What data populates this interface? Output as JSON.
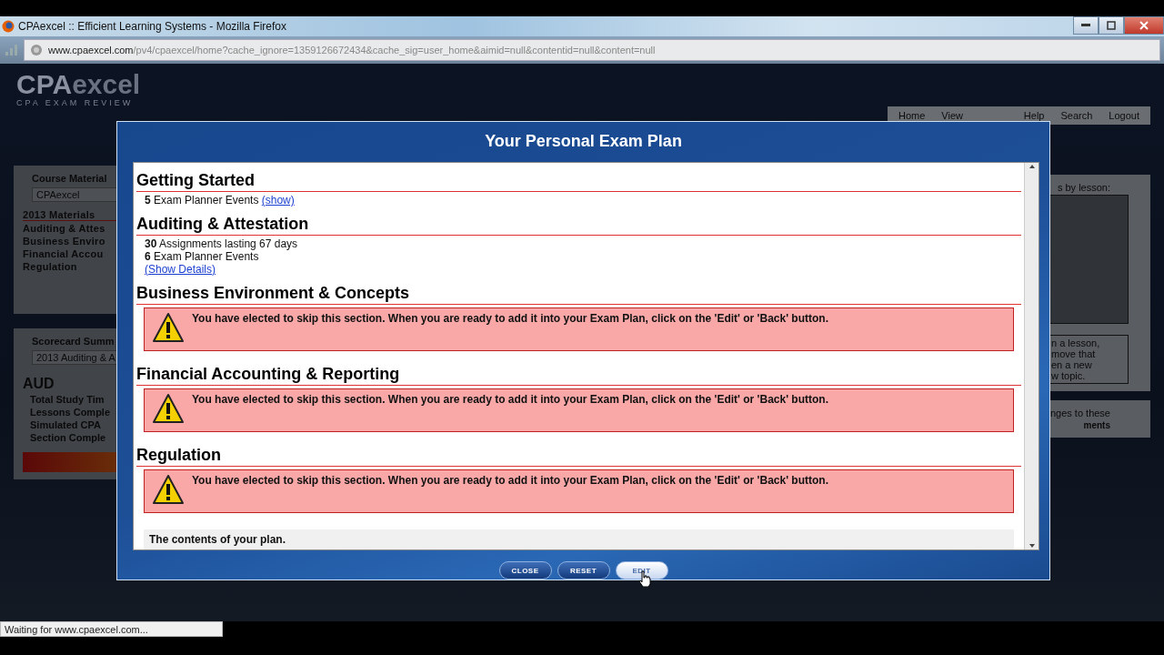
{
  "browser": {
    "title": "CPAexcel :: Efficient Learning Systems - Mozilla Firefox",
    "url_domain": "www.cpaexcel.com",
    "url_path": "/pv4/cpaexcel/home?cache_ignore=1359126672434&cache_sig=user_home&aimid=null&contentid=null&content=null",
    "status": "Waiting for www.cpaexcel.com..."
  },
  "site": {
    "logo_a": "CPA",
    "logo_b": "excel",
    "tagline": "CPA EXAM REVIEW",
    "nav_left": [
      "Home",
      "View"
    ],
    "nav_right": [
      "Help",
      "Search",
      "Logout"
    ]
  },
  "sidebar": {
    "course_title": "Course Material",
    "course_select": "CPAexcel",
    "items": [
      {
        "label": "2013 Materials",
        "kind": "heading"
      },
      {
        "label": "Auditing & Attes",
        "kind": "item"
      },
      {
        "label": "Business Enviro",
        "kind": "item"
      },
      {
        "label": "Financial Accou",
        "kind": "item"
      },
      {
        "label": "Regulation",
        "kind": "item"
      }
    ],
    "score_title": "Scorecard Summ",
    "score_select": "2013 Auditing & A",
    "section": "AUD",
    "rows": [
      "Total Study Tim",
      "Lessons Comple",
      "Simulated CPA",
      "Section Comple"
    ]
  },
  "right_panel": {
    "top": [
      "s by lesson:"
    ],
    "box": [
      "n a lesson,",
      "move that",
      "en a new",
      "w topic."
    ],
    "bottom": [
      "nges to these"
    ],
    "label": "ments"
  },
  "modal": {
    "title": "Your Personal Exam Plan",
    "sections": [
      {
        "heading": "Getting Started",
        "kind": "plan",
        "lines": [
          {
            "text": "**5** Exam Planner Events",
            "link": "(show)"
          }
        ]
      },
      {
        "heading": "Auditing & Attestation",
        "kind": "plan",
        "lines": [
          {
            "text": "**30** Assignments lasting 67 days"
          },
          {
            "text": "**6** Exam Planner Events"
          }
        ],
        "details": "(Show Details)"
      },
      {
        "heading": "Business Environment & Concepts",
        "kind": "skipped",
        "message": "You have elected to skip this section. When you are ready to add it into your Exam Plan, click on the 'Edit' or 'Back' button."
      },
      {
        "heading": "Financial Accounting & Reporting",
        "kind": "skipped",
        "message": "You have elected to skip this section. When you are ready to add it into your Exam Plan, click on the 'Edit' or 'Back' button."
      },
      {
        "heading": "Regulation",
        "kind": "skipped",
        "message": "You have elected to skip this section. When you are ready to add it into your Exam Plan, click on the 'Edit' or 'Back' button."
      }
    ],
    "note": "The contents of your plan.",
    "buttons": [
      {
        "label": "CLOSE",
        "hover": false
      },
      {
        "label": "RESET",
        "hover": false
      },
      {
        "label": "EDIT",
        "hover": true
      }
    ]
  }
}
